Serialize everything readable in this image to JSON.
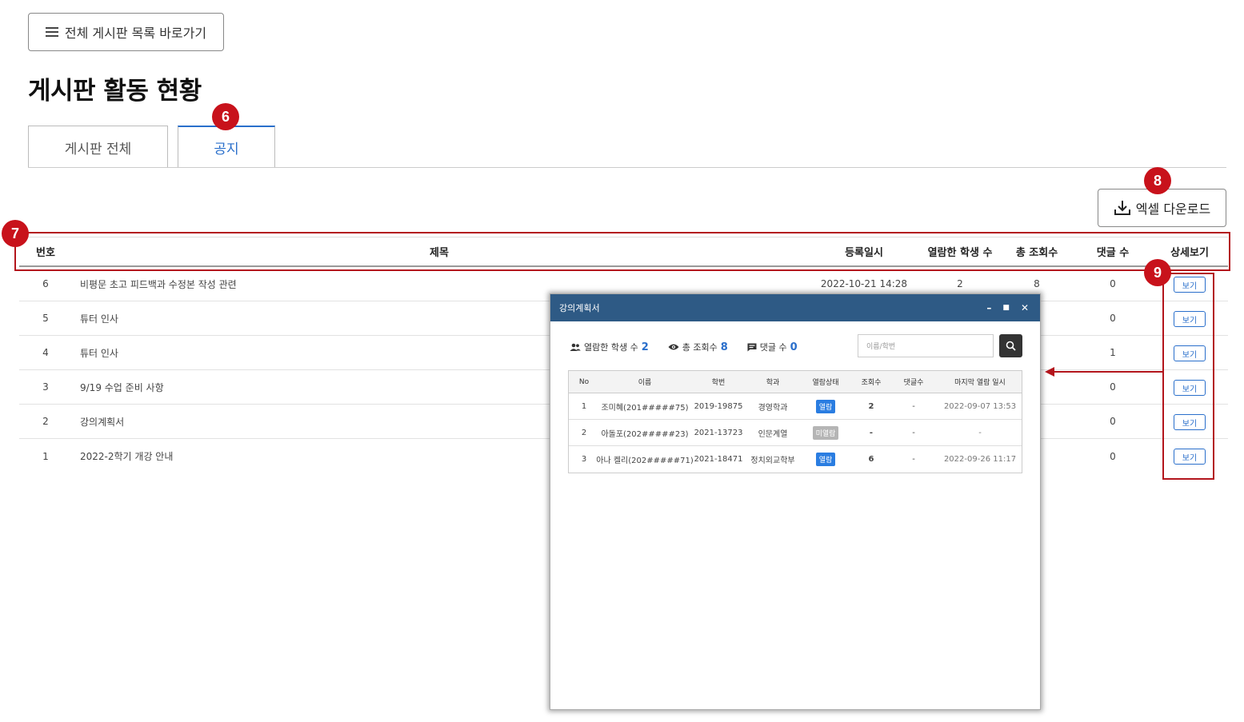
{
  "top": {
    "list_button_label": "전체 게시판 목록 바로가기",
    "page_title": "게시판 활동 현황"
  },
  "tabs": [
    {
      "label": "게시판 전체",
      "active": false
    },
    {
      "label": "공지",
      "active": true
    }
  ],
  "markers": {
    "m6": "6",
    "m7": "7",
    "m8": "8",
    "m9": "9"
  },
  "excel_button_label": "엑셀 다운로드",
  "table": {
    "headers": {
      "no": "번호",
      "title": "제목",
      "date": "등록일시",
      "students": "열람한 학생 수",
      "views": "총 조회수",
      "comments": "댓글 수",
      "detail": "상세보기"
    },
    "rows": [
      {
        "no": "6",
        "title": "비평문 초고 피드백과 수정본 작성 관련",
        "date": "2022-10-21 14:28",
        "students": "2",
        "views": "8",
        "comments": "0",
        "btn": "보기"
      },
      {
        "no": "5",
        "title": "튜터 인사",
        "date": "",
        "students": "",
        "views": "",
        "comments": "0",
        "btn": "보기"
      },
      {
        "no": "4",
        "title": "튜터 인사",
        "date": "",
        "students": "",
        "views": "",
        "comments": "1",
        "btn": "보기"
      },
      {
        "no": "3",
        "title": "9/19 수업 준비 사항",
        "date": "",
        "students": "",
        "views": "",
        "comments": "0",
        "btn": "보기"
      },
      {
        "no": "2",
        "title": "강의계획서",
        "date": "",
        "students": "",
        "views": "",
        "comments": "0",
        "btn": "보기"
      },
      {
        "no": "1",
        "title": "2022-2학기 개강 안내",
        "date": "",
        "students": "",
        "views": "",
        "comments": "0",
        "btn": "보기"
      }
    ]
  },
  "modal": {
    "title": "강의계획서",
    "controls": {
      "minimize": "–",
      "maximize": "■",
      "close": "✕"
    },
    "stats": {
      "students_label": "열람한 학생 수",
      "students_value": "2",
      "views_label": "총 조회수",
      "views_value": "8",
      "comments_label": "댓글 수",
      "comments_value": "0"
    },
    "search_placeholder": "이름/학번",
    "headers": {
      "no": "No",
      "name": "이름",
      "student_id": "학번",
      "dept": "학과",
      "status": "열람상태",
      "views": "조회수",
      "comments": "댓글수",
      "last": "마지막 열람 일시"
    },
    "rows": [
      {
        "no": "1",
        "name": "조미혜(201#####75)",
        "student_id": "2019-19875",
        "dept": "경영학과",
        "status": "열람",
        "status_on": true,
        "views": "2",
        "comments": "-",
        "last": "2022-09-07 13:53"
      },
      {
        "no": "2",
        "name": "아돌포(202#####23)",
        "student_id": "2021-13723",
        "dept": "인문계열",
        "status": "미열람",
        "status_on": false,
        "views": "-",
        "comments": "-",
        "last": "-"
      },
      {
        "no": "3",
        "name": "아나 켈리(202#####71)",
        "student_id": "2021-18471",
        "dept": "정치외교학부",
        "status": "열람",
        "status_on": true,
        "views": "6",
        "comments": "-",
        "last": "2022-09-26 11:17"
      }
    ]
  },
  "colors": {
    "accent": "#2a6fcb",
    "marker": "#c8121b",
    "modal_header": "#2e5a85",
    "badge_on": "#2a7de1",
    "badge_off": "#b5b5b5"
  }
}
